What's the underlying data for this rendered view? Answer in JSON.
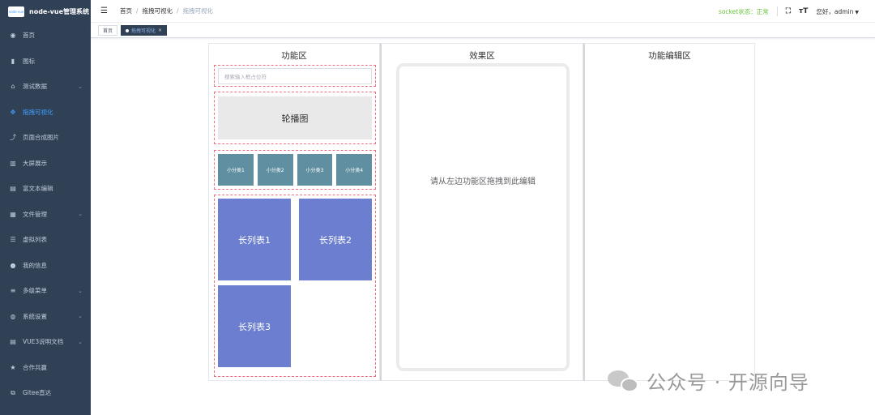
{
  "app": {
    "logo_text": "node-vue管理系统",
    "logo_badge": "node-vue"
  },
  "sidebar": {
    "items": [
      {
        "label": "首页",
        "icon": "dashboard-icon",
        "glyph": "◉",
        "expandable": false,
        "active": false
      },
      {
        "label": "图标",
        "icon": "book-icon",
        "glyph": "▮",
        "expandable": false,
        "active": false
      },
      {
        "label": "测试数据",
        "icon": "bank-icon",
        "glyph": "⌂",
        "expandable": true,
        "active": false
      },
      {
        "label": "拖拽可视化",
        "icon": "move-icon",
        "glyph": "✥",
        "expandable": false,
        "active": true
      },
      {
        "label": "页面合成图片",
        "icon": "share-icon",
        "glyph": "⤴",
        "expandable": false,
        "active": false
      },
      {
        "label": "大屏展示",
        "icon": "bar-chart-icon",
        "glyph": "▥",
        "expandable": false,
        "active": false
      },
      {
        "label": "富文本编辑",
        "icon": "document-icon",
        "glyph": "▤",
        "expandable": false,
        "active": false
      },
      {
        "label": "文件管理",
        "icon": "folder-icon",
        "glyph": "▦",
        "expandable": true,
        "active": false
      },
      {
        "label": "虚拟列表",
        "icon": "list-icon",
        "glyph": "☰",
        "expandable": false,
        "active": false
      },
      {
        "label": "我的信息",
        "icon": "user-icon",
        "glyph": "●",
        "expandable": false,
        "active": false
      },
      {
        "label": "多级菜单",
        "icon": "tree-icon",
        "glyph": "≡",
        "expandable": true,
        "active": false
      },
      {
        "label": "系统设置",
        "icon": "globe-icon",
        "glyph": "◍",
        "expandable": true,
        "active": false
      },
      {
        "label": "VUE3说明文档",
        "icon": "doc-icon",
        "glyph": "▤",
        "expandable": true,
        "active": false
      },
      {
        "label": "合作共赢",
        "icon": "star-icon",
        "glyph": "★",
        "expandable": false,
        "active": false
      },
      {
        "label": "Gitee直达",
        "icon": "external-link-icon",
        "glyph": "⧉",
        "expandable": false,
        "active": false
      }
    ]
  },
  "header": {
    "breadcrumb": [
      "首页",
      "拖拽可视化",
      "拖拽可视化"
    ],
    "breadcrumb_sep": "/",
    "socket_status": "socket状态：正常",
    "font_size_glyph": "тT",
    "fullscreen_glyph": "⛶",
    "user_greeting": "您好，admin"
  },
  "tags": [
    {
      "label": "首页",
      "active": false
    },
    {
      "label": "拖拽可视化",
      "active": true
    }
  ],
  "panels": {
    "function_title": "功能区",
    "effect_title": "效果区",
    "edit_title": "功能编辑区"
  },
  "components": {
    "search_placeholder": "搜索输入框占位符",
    "carousel_label": "轮播图",
    "categories": [
      "小分类1",
      "小分类2",
      "小分类3",
      "小分类4"
    ],
    "long_lists": [
      "长列表1",
      "长列表2",
      "长列表3"
    ]
  },
  "effect_hint": "请从左边功能区拖拽到此编辑",
  "watermark": {
    "text": "公众号 · 开源向导",
    "icon": "wechat-icon"
  },
  "colors": {
    "sidebar_bg": "#304156",
    "active": "#409eff",
    "socket_ok": "#67c23a",
    "category_bg": "#5f8fa1",
    "long_list_bg": "#6b7ecf",
    "dashed_border": "#ee6f80"
  }
}
